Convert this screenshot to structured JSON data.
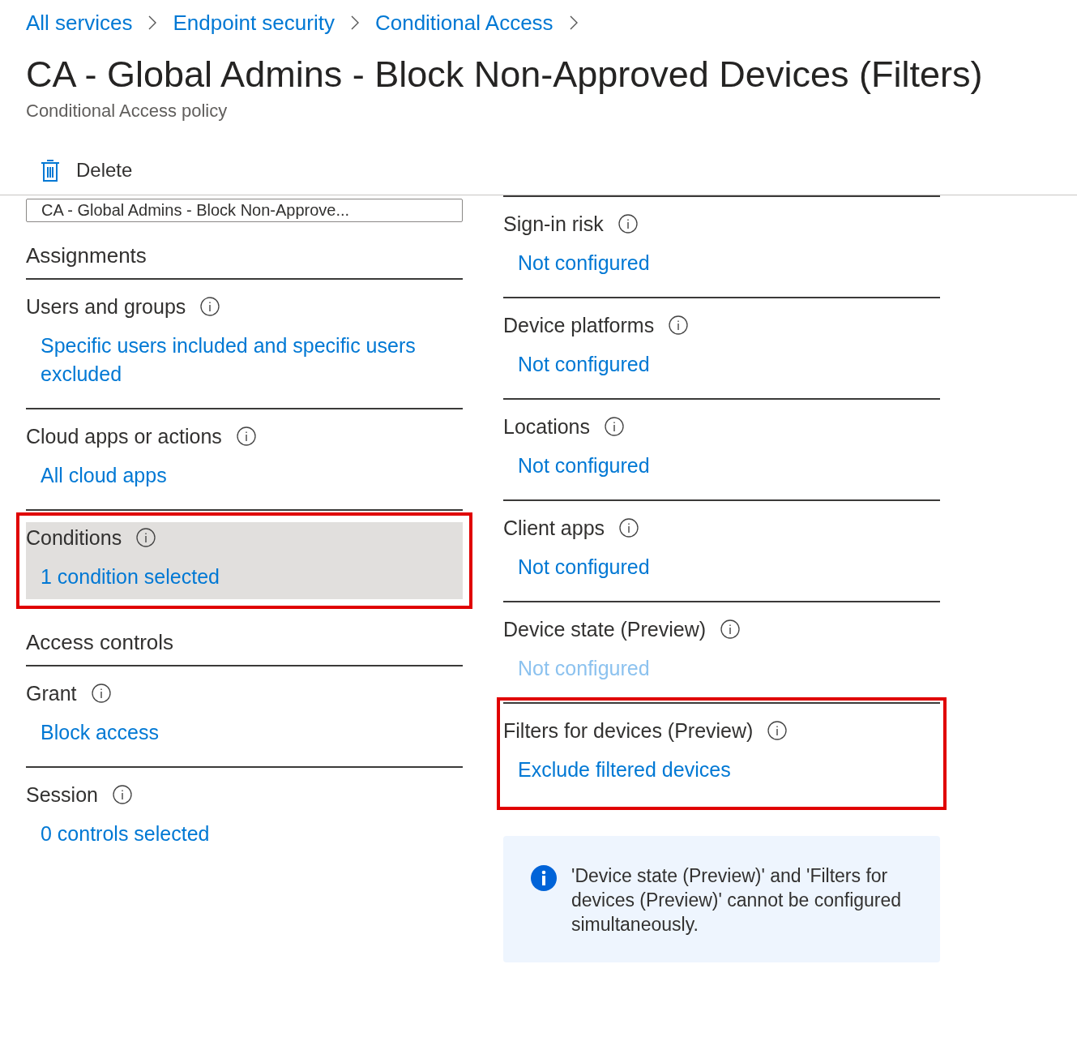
{
  "breadcrumb": [
    {
      "label": "All services"
    },
    {
      "label": "Endpoint security"
    },
    {
      "label": "Conditional Access"
    }
  ],
  "title": "CA - Global Admins - Block Non-Approved Devices (Filters)",
  "subtitle": "Conditional Access policy",
  "toolbar": {
    "delete": "Delete"
  },
  "name_field": {
    "value": "CA - Global Admins - Block Non-Approve..."
  },
  "left_sections": [
    {
      "heading": "Assignments",
      "items": [
        {
          "label": "Users and groups",
          "value": "Specific users included and specific users excluded",
          "selected": false,
          "highlighted": false
        },
        {
          "label": "Cloud apps or actions",
          "value": "All cloud apps",
          "selected": false,
          "highlighted": false
        },
        {
          "label": "Conditions",
          "value": "1 condition selected",
          "selected": true,
          "highlighted": true
        }
      ]
    },
    {
      "heading": "Access controls",
      "items": [
        {
          "label": "Grant",
          "value": "Block access",
          "selected": false,
          "highlighted": false
        },
        {
          "label": "Session",
          "value": "0 controls selected",
          "selected": false,
          "highlighted": false
        }
      ]
    }
  ],
  "conditions": [
    {
      "label": "Sign-in risk",
      "value": "Not configured",
      "disabled": false,
      "highlighted": false
    },
    {
      "label": "Device platforms",
      "value": "Not configured",
      "disabled": false,
      "highlighted": false
    },
    {
      "label": "Locations",
      "value": "Not configured",
      "disabled": false,
      "highlighted": false
    },
    {
      "label": "Client apps",
      "value": "Not configured",
      "disabled": false,
      "highlighted": false
    },
    {
      "label": "Device state (Preview)",
      "value": "Not configured",
      "disabled": true,
      "highlighted": false
    },
    {
      "label": "Filters for devices (Preview)",
      "value": "Exclude filtered devices",
      "disabled": false,
      "highlighted": true
    }
  ],
  "info_message": "'Device state (Preview)' and 'Filters for devices (Preview)' cannot be configured simultaneously."
}
